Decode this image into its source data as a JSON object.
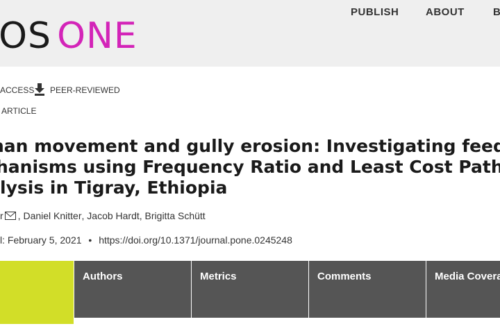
{
  "header": {
    "logo_part1": "LOS",
    "logo_part2": "ONE",
    "nav": [
      "PUBLISH",
      "ABOUT",
      "B"
    ]
  },
  "badges": {
    "access": "ACCESS",
    "peer_reviewed": "PEER-REVIEWED",
    "article_type": "ARTICLE"
  },
  "article": {
    "title_lines": [
      "nan movement and gully erosion: Investigating feedb",
      "hanisms using Frequency Ratio and Least Cost Path",
      "lysis in Tigray, Ethiopia"
    ],
    "first_author_fragment": "r",
    "authors": [
      "Daniel Knitter",
      "Jacob Hardt",
      "Brigitta Schütt"
    ],
    "published_fragment": "l: February 5, 2021",
    "doi": "https://doi.org/10.1371/journal.pone.0245248"
  },
  "tabs": [
    "Authors",
    "Metrics",
    "Comments",
    "Media Covera"
  ],
  "colors": {
    "brand_magenta": "#d324b8",
    "header_bg": "#efefef",
    "tab_bg": "#555555",
    "active_tab": "#d2de28"
  }
}
